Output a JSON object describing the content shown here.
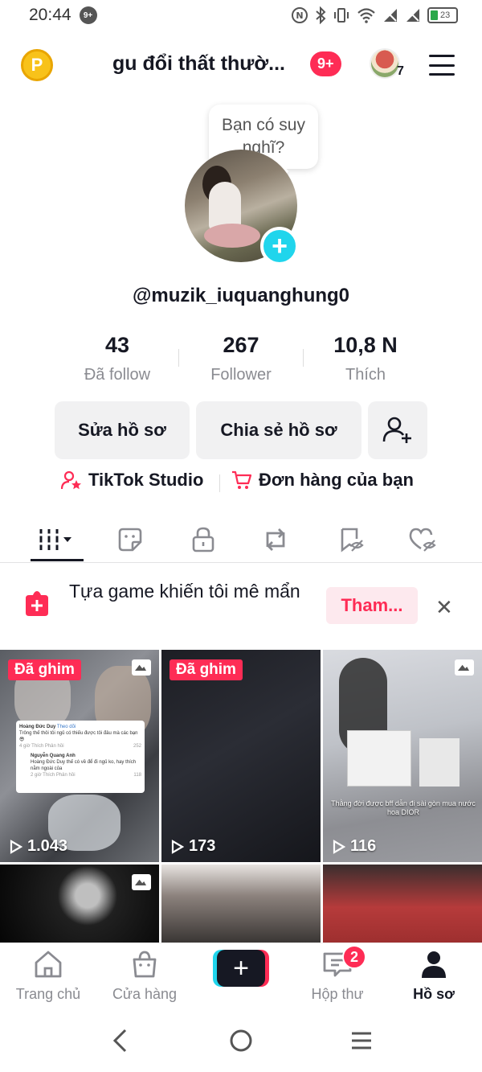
{
  "status_bar": {
    "time": "20:44",
    "notification_badge": "9+",
    "battery": "23"
  },
  "header": {
    "title": "gu đổi thất thườ...",
    "badge": "9+",
    "account_count": "7",
    "coin_letter": "P"
  },
  "profile": {
    "bubble_text": "Bạn có suy nghĩ?",
    "handle": "@muzik_iuquanghung0",
    "stats": [
      {
        "value": "43",
        "label": "Đã follow"
      },
      {
        "value": "267",
        "label": "Follower"
      },
      {
        "value": "10,8 N",
        "label": "Thích"
      }
    ],
    "edit_button": "Sửa hồ sơ",
    "share_button": "Chia sẻ hồ sơ",
    "studio_link": "TikTok Studio",
    "orders_link": "Đơn hàng của bạn"
  },
  "promo": {
    "text": "Tựa game khiến tôi mê mẩn",
    "button": "Tham...",
    "close": "✕"
  },
  "grid": {
    "pinned_label": "Đã ghim",
    "videos": [
      {
        "views": "1.043",
        "pinned": true,
        "photo": true
      },
      {
        "views": "173",
        "pinned": true,
        "photo": false
      },
      {
        "views": "116",
        "pinned": false,
        "photo": true
      },
      {
        "views": "",
        "pinned": false,
        "photo": true
      },
      {
        "views": "",
        "pinned": false,
        "photo": false
      },
      {
        "views": "",
        "pinned": false,
        "photo": false
      }
    ],
    "comment_card": {
      "user1": "Hoàng Đức Duy",
      "follow": "Theo dõi",
      "text1": "Trông thế thôi tôi ngủ có thiếu được tôi đâu mà các bạn 😎",
      "meta1": "4 giờ   Thích   Phản hồi",
      "count1": "252",
      "user2": "Nguyễn Quang Anh",
      "text2": "Hoàng Đức Duy thế có về để đi ngủ ko, hay thích nằm ngoài của",
      "meta2": "2 giờ   Thích   Phản hồi",
      "count2": "118"
    },
    "caption3": "Thằng đời được bff dẫn đi sài gòn mua nước hoa DIOR"
  },
  "bottom_nav": {
    "home": "Trang chủ",
    "shop": "Cửa hàng",
    "create": "+",
    "inbox": "Hộp thư",
    "inbox_badge": "2",
    "profile": "Hồ sơ"
  },
  "colors": {
    "brand_red": "#fe2c55",
    "brand_cyan": "#20d5ec",
    "text_dark": "#161823",
    "text_gray": "#8a8b91"
  }
}
